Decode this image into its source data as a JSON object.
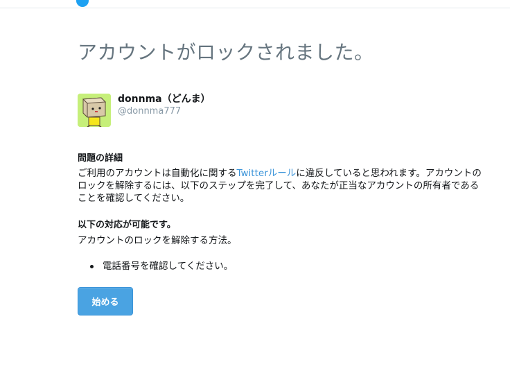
{
  "colors": {
    "title": "#66757f",
    "link": "#3b94d9",
    "button": "#4aa3e2",
    "screenname": "#8899a6"
  },
  "page": {
    "title": "アカウントがロックされました。"
  },
  "account": {
    "fullname": "donnma（どんま）",
    "screenname": "@donnma777",
    "avatar_icon": "box-character-avatar"
  },
  "details": {
    "heading": "問題の詳細",
    "text_before": "ご利用のアカウントは自動化に関する",
    "link_text": "Twitterルール",
    "text_after": "に違反していると思われます。アカウントのロックを解除するには、以下のステップを完了して、あなたが正当なアカウントの所有者であることを確認してください。"
  },
  "options": {
    "heading": "以下の対応が可能です。",
    "subtext": "アカウントのロックを解除する方法。",
    "steps": [
      "電話番号を確認してください。"
    ]
  },
  "actions": {
    "start_label": "始める"
  }
}
